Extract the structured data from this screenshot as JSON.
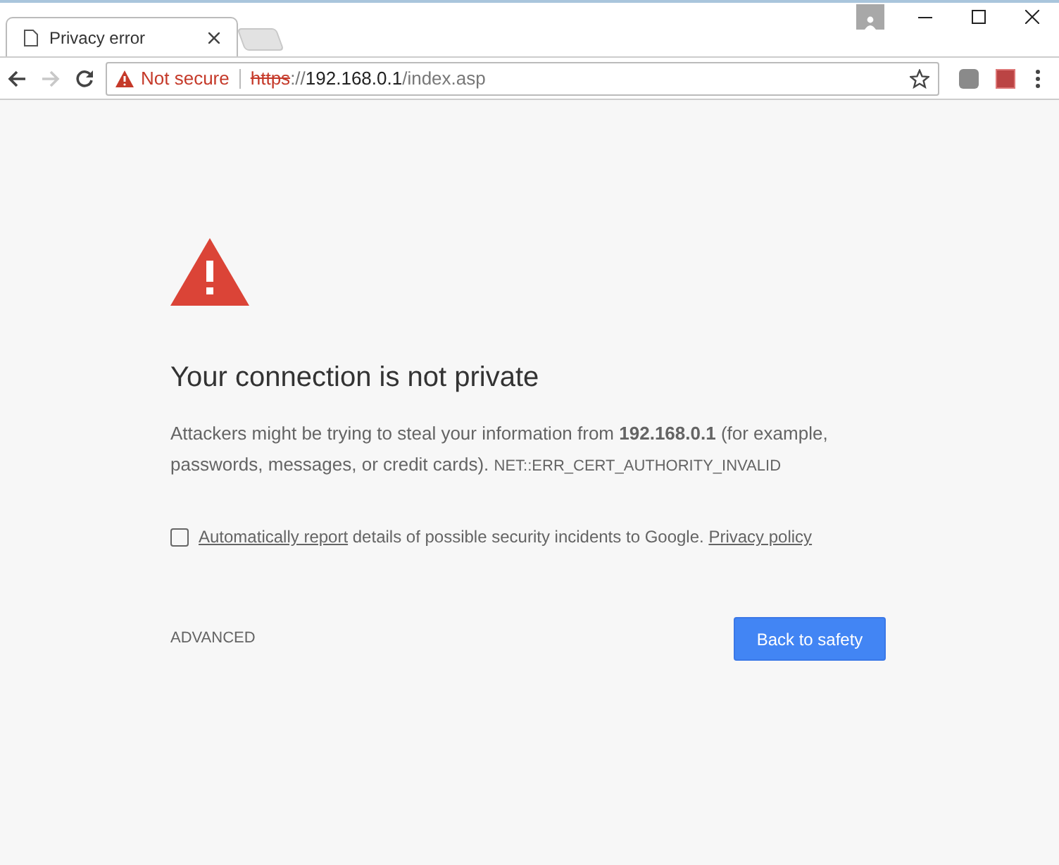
{
  "tabs": [
    {
      "title": "Privacy error",
      "selected": true
    }
  ],
  "address_bar": {
    "security_label": "Not secure",
    "url_scheme": "https",
    "url_separator": "://",
    "url_host": "192.168.0.1",
    "url_path": "/index.asp"
  },
  "error_page": {
    "heading": "Your connection is not private",
    "message": "Attackers might be trying to steal your information from **192.168.0.1** (for example, passwords, messages, or credit cards).",
    "error_code": "NET::ERR_CERT_AUTHORITY_INVALID",
    "report": {
      "checked": false,
      "link": "Automatically report",
      "text": " details of possible security incidents to Google. ",
      "policy_link": "Privacy policy"
    },
    "advanced_label": "ADVANCED",
    "primary_button": "Back to safety"
  }
}
